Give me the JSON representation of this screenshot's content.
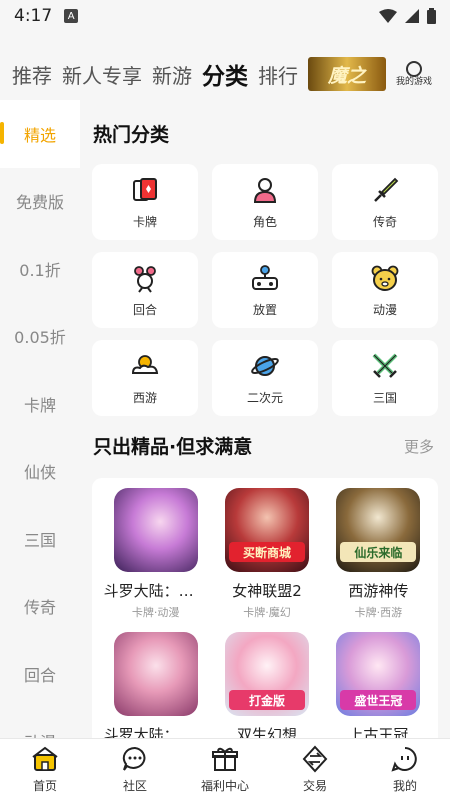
{
  "status": {
    "time": "4:17",
    "app_indicator": "A"
  },
  "tabs": [
    {
      "label": "推荐"
    },
    {
      "label": "新人专享"
    },
    {
      "label": "新游"
    },
    {
      "label": "分类"
    },
    {
      "label": "排行"
    }
  ],
  "banner_text": "魔之",
  "my_games_label": "我的游戏",
  "sidebar": [
    "精选",
    "免费版",
    "0.1折",
    "0.05折",
    "卡牌",
    "仙侠",
    "三国",
    "传奇",
    "回合",
    "动漫"
  ],
  "hot_categories": {
    "title": "热门分类",
    "items": [
      {
        "label": "卡牌",
        "icon": "cards-icon"
      },
      {
        "label": "角色",
        "icon": "person-icon"
      },
      {
        "label": "传奇",
        "icon": "sword-icon"
      },
      {
        "label": "回合",
        "icon": "turn-icon"
      },
      {
        "label": "放置",
        "icon": "joystick-icon"
      },
      {
        "label": "动漫",
        "icon": "bear-icon"
      },
      {
        "label": "西游",
        "icon": "cloud-icon"
      },
      {
        "label": "二次元",
        "icon": "planet-icon"
      },
      {
        "label": "三国",
        "icon": "crossed-swords-icon"
      }
    ]
  },
  "featured": {
    "title": "只出精品·但求满意",
    "more": "更多",
    "games": [
      {
        "name": "斗罗大陆：武...",
        "tags": "卡牌·动漫",
        "badge": ""
      },
      {
        "name": "女神联盟2",
        "tags": "卡牌·魔幻",
        "badge": "买断商城"
      },
      {
        "name": "西游神传",
        "tags": "卡牌·西游",
        "badge": "仙乐来临"
      },
      {
        "name": "斗罗大陆：逆...",
        "tags": "",
        "badge": ""
      },
      {
        "name": "双生幻想",
        "tags": "",
        "badge": "打金版"
      },
      {
        "name": "上古王冠",
        "tags": "",
        "badge": "盛世王冠"
      }
    ]
  },
  "bottom_nav": [
    {
      "label": "首页",
      "icon": "home-icon"
    },
    {
      "label": "社区",
      "icon": "chat-icon"
    },
    {
      "label": "福利中心",
      "icon": "gift-icon"
    },
    {
      "label": "交易",
      "icon": "exchange-icon"
    },
    {
      "label": "我的",
      "icon": "profile-icon"
    }
  ],
  "colors": {
    "accent": "#f5b400",
    "background": "#f6f6f6"
  }
}
